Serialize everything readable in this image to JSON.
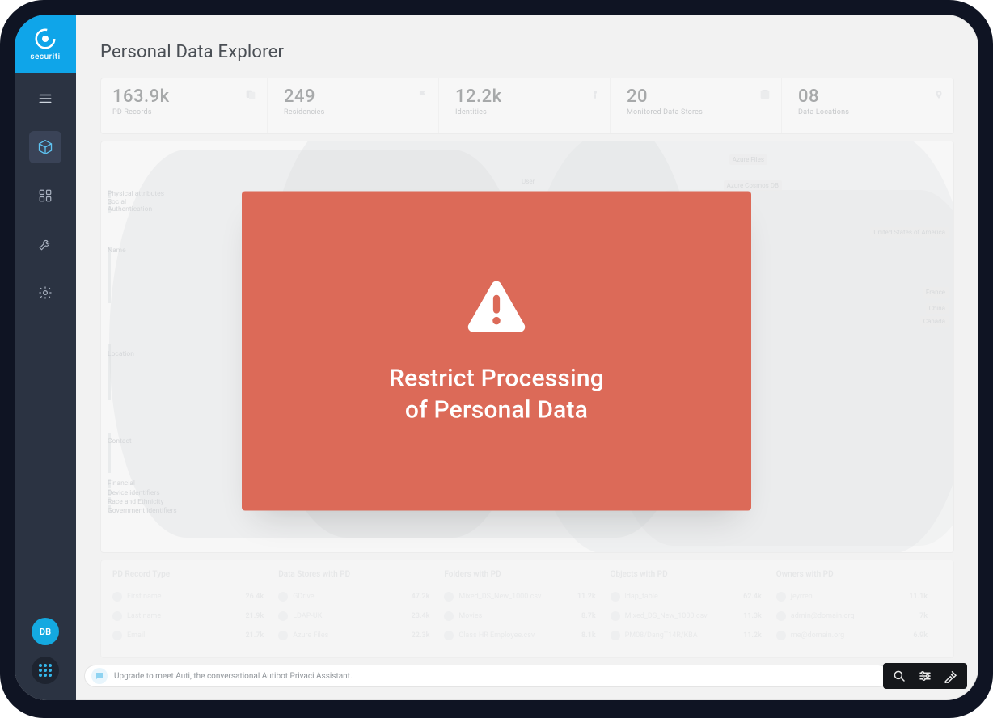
{
  "brand": {
    "name": "securiti"
  },
  "sidebar": {
    "avatar_initials": "DB"
  },
  "page": {
    "title": "Personal Data Explorer"
  },
  "kpis": [
    {
      "value": "163.9k",
      "label": "PD Records"
    },
    {
      "value": "249",
      "label": "Residencies"
    },
    {
      "value": "12.2k",
      "label": "Identities"
    },
    {
      "value": "20",
      "label": "Monitored Data Stores"
    },
    {
      "value": "08",
      "label": "Data Locations"
    }
  ],
  "sankey": {
    "left_categories": [
      "Physical attributes",
      "Social",
      "Authentication",
      "Name",
      "Location",
      "Contact",
      "Financial",
      "Device identifiers",
      "Race and Ethnicity",
      "Government identifiers"
    ],
    "middle_nodes": [
      "User"
    ],
    "right_nodes_top": [
      "Azure Files",
      "Azure Cosmos DB"
    ],
    "right_nodes_bottom": [
      "United States of America",
      "France",
      "China",
      "Canada"
    ]
  },
  "table": {
    "headers": [
      "PD Record Type",
      "Data Stores with PD",
      "Folders with PD",
      "Objects with PD",
      "Owners with PD"
    ],
    "rows": [
      [
        {
          "label": "First name",
          "value": "26.4k"
        },
        {
          "label": "GDrive",
          "value": "47.2k"
        },
        {
          "label": "Mixed_DS_New_1000.csv",
          "value": "11.2k"
        },
        {
          "label": "ldap_table",
          "value": "62.4k"
        },
        {
          "label": "jeyrren",
          "value": "11.1k"
        }
      ],
      [
        {
          "label": "Last name",
          "value": "21.9k"
        },
        {
          "label": "LDAP-UK",
          "value": "23.4k"
        },
        {
          "label": "Movies",
          "value": "8.7k"
        },
        {
          "label": "Mixed_DS_New_1000.csv",
          "value": "11.3k"
        },
        {
          "label": "admin@domain.org",
          "value": "7k"
        }
      ],
      [
        {
          "label": "Email",
          "value": "21.7k"
        },
        {
          "label": "Azure Files",
          "value": "22.3k"
        },
        {
          "label": "Class HR Employee.csv",
          "value": "8.1k"
        },
        {
          "label": "PM08/DangT14R/KBA",
          "value": "11.2k"
        },
        {
          "label": "me@domain.org",
          "value": "6.9k"
        }
      ]
    ]
  },
  "footer": {
    "message": "Upgrade to meet Auti, the conversational Autibot Privaci Assistant."
  },
  "modal": {
    "line1": "Restrict Processing",
    "line2": "of Personal Data"
  }
}
